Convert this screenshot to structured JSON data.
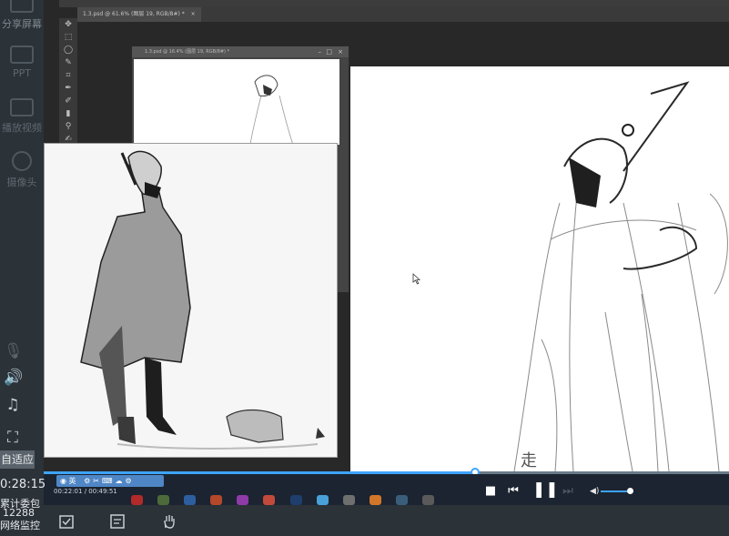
{
  "sidebar": {
    "items": [
      {
        "label": "分享屏幕",
        "icon": "share-screen-icon"
      },
      {
        "label": "PPT",
        "icon": "ppt-icon"
      },
      {
        "label": "播放视频",
        "icon": "play-video-icon"
      },
      {
        "label": "摄像头",
        "icon": "camera-icon"
      }
    ],
    "mic_icon": "mic-muted-icon",
    "speaker_icon": "speaker-icon",
    "music_icon": "music-icon",
    "fullscreen_icon": "fullscreen-icon",
    "fit_label": "自适应",
    "elapsed": "0:28:15",
    "stats_label": "累计委包",
    "stats_value": "12288",
    "network_label": "网络监控"
  },
  "photoshop": {
    "tab_title": "1.3.psd @ 61.6% (图层 19, RGB/8#) *",
    "window_title": "1.3.psd @ 16.4% (图层 19, RGB/8#) *",
    "tools": [
      "✥",
      "⬚",
      "◯",
      "✎",
      "⌗",
      "✒",
      "✐",
      "▮",
      "⚲",
      "✍"
    ]
  },
  "player": {
    "subtitle": "走",
    "current_time": "00:22:01",
    "total_time": "00:49:51",
    "progress": 0.63,
    "volume": 0.85,
    "ime_label": "英",
    "accent": "#3da3ff"
  },
  "bottom_tools": [
    {
      "name": "checklist-icon"
    },
    {
      "name": "notes-icon"
    },
    {
      "name": "raise-hand-icon"
    }
  ]
}
